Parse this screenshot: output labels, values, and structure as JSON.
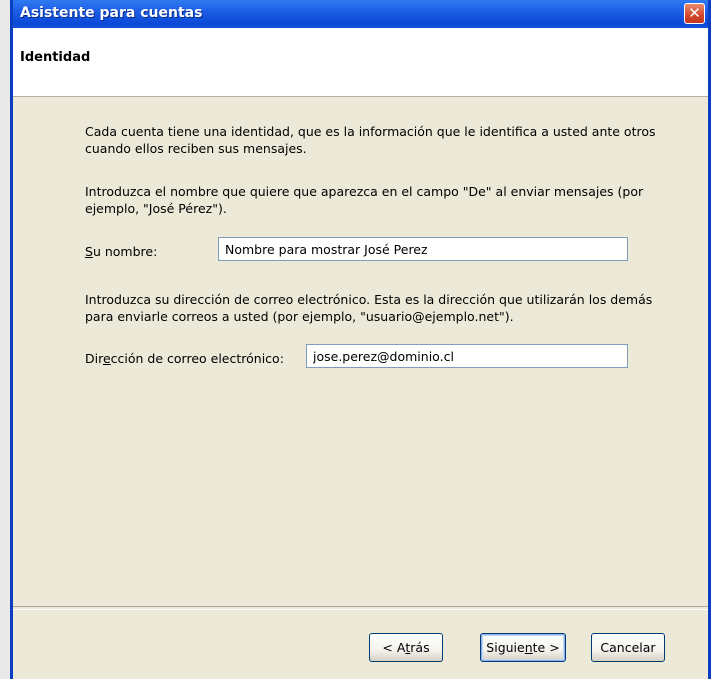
{
  "window": {
    "title": "Asistente para cuentas"
  },
  "header": {
    "title": "Identidad"
  },
  "content": {
    "intro": "Cada cuenta tiene una identidad, que es la información que le identifica a usted ante otros cuando ellos reciben sus mensajes.",
    "name_instructions": "Introduzca el nombre que quiere que aparezca en el campo \"De\" al enviar mensajes (por ejemplo, \"José Pérez\").",
    "name_label_prefix": "",
    "name_label_accel": "S",
    "name_label_rest": "u nombre:",
    "name_value": "Nombre para mostrar José Perez",
    "email_instructions": "Introduzca su dirección de correo electrónico. Esta es la dirección que utilizarán los demás para enviarle correos a usted (por ejemplo, \"usuario@ejemplo.net\").",
    "email_label_prefix": "Dir",
    "email_label_accel": "e",
    "email_label_rest": "cción de correo electrónico:",
    "email_value": "jose.perez@dominio.cl"
  },
  "buttons": {
    "back_prefix": "< A",
    "back_accel": "t",
    "back_rest": "rás",
    "next_prefix": "Siguie",
    "next_accel": "n",
    "next_rest": "te >",
    "cancel": "Cancelar"
  },
  "icons": {
    "close": "close-icon"
  },
  "colors": {
    "titlebar": "#0b49d6",
    "close": "#d2462a",
    "dialog_bg": "#ece9d8"
  }
}
